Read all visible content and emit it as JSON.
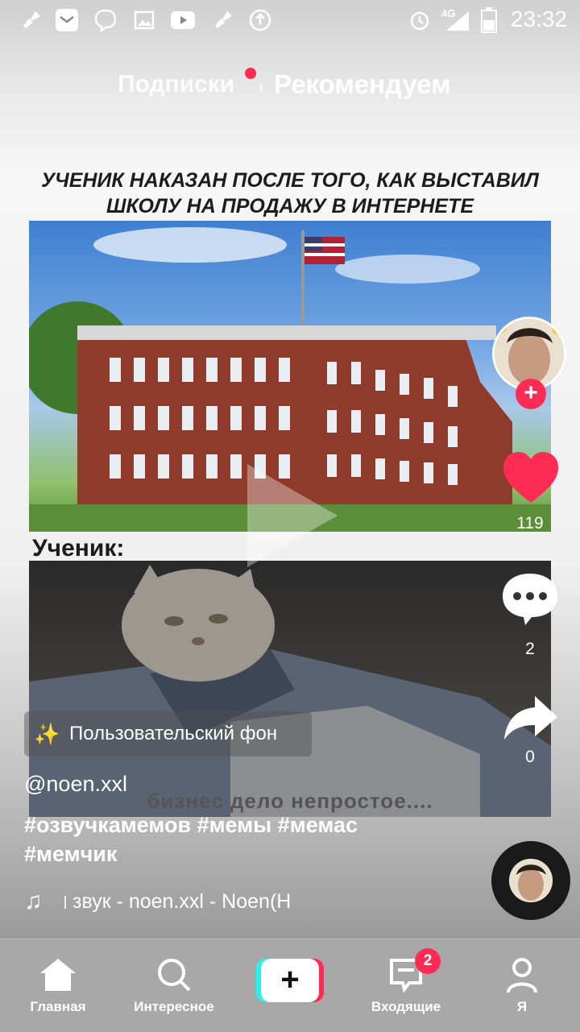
{
  "status_bar": {
    "time": "23:32",
    "network": "4G",
    "icons": [
      "broom-icon",
      "mail-icon",
      "viber-icon",
      "image-icon",
      "youtube-icon",
      "broom-icon",
      "upload-icon",
      "alarm-icon",
      "signal-icon",
      "battery-icon"
    ]
  },
  "top_tabs": {
    "following": "Подписки",
    "for_you": "Рекомендуем"
  },
  "meme": {
    "caption_line1": "УЧЕНИК НАКАЗАН ПОСЛЕ ТОГО, КАК ВЫСТАВИЛ",
    "caption_line2": "ШКОЛУ НА ПРОДАЖУ В ИНТЕРНЕТЕ",
    "label": "Ученик:",
    "subtitle": "бизнес дело непростое...."
  },
  "right_rail": {
    "likes": "119",
    "comments": "2",
    "shares": "0",
    "follow_symbol": "+"
  },
  "effect": {
    "label": "Пользовательский фон"
  },
  "post": {
    "username": "@noen.xxl",
    "hashtags_line1": "#озвучкамемов #мемы #мемас",
    "hashtags_line2": "#мемчик",
    "music": "звук - noen.xxl - Noen(Н"
  },
  "bottom_nav": {
    "home": "Главная",
    "discover": "Интересное",
    "create_symbol": "+",
    "inbox": "Входящие",
    "inbox_badge": "2",
    "me": "Я"
  },
  "colors": {
    "accent": "#fe2c55",
    "cyan": "#25f4ee"
  }
}
